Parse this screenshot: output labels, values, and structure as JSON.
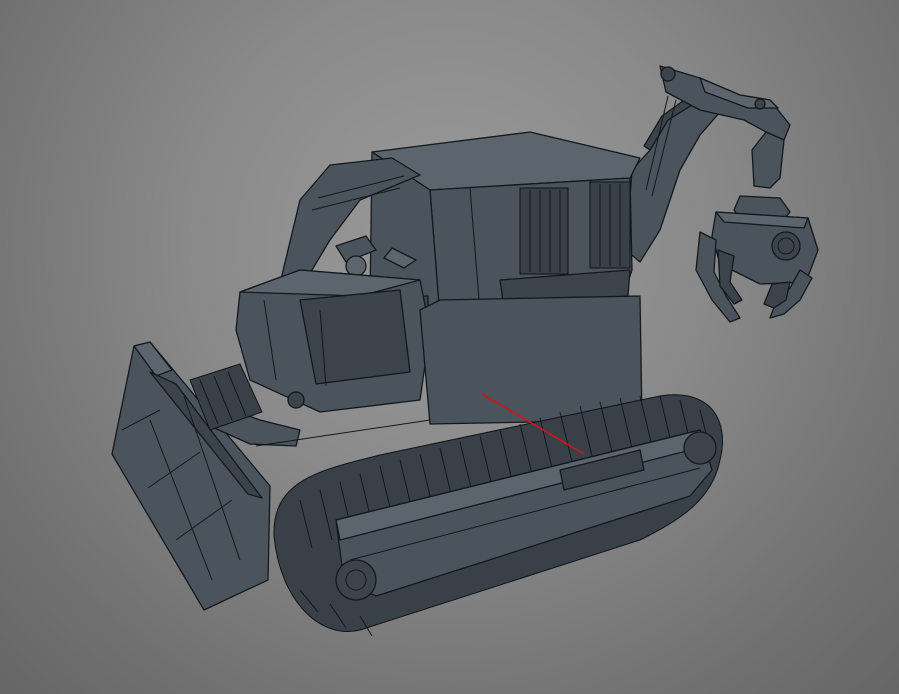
{
  "viewport": {
    "background_color": "#888888",
    "model_color": "#4b535c",
    "wire_color": "#14181c",
    "axis_color": "#e01010"
  }
}
